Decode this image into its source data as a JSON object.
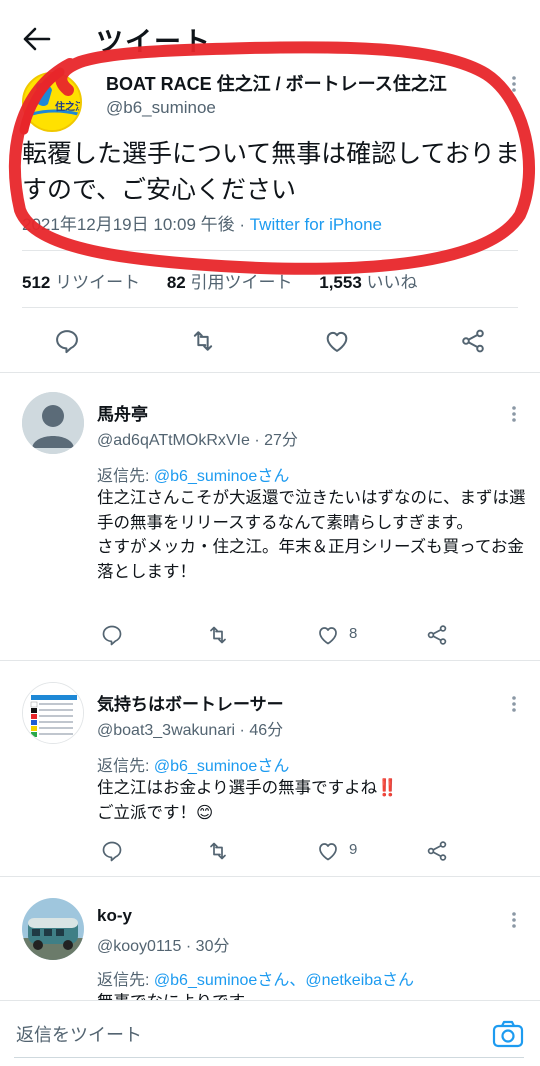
{
  "header": {
    "title": "ツイート"
  },
  "main_tweet": {
    "name": "BOAT RACE 住之江 / ボートレース住之江",
    "handle": "@b6_suminoe",
    "avatar_text": "住之江",
    "text": "転覆した選手について無事は確認しておりますので、ご安心ください",
    "timestamp": "2021年12月19日 10:09 午後",
    "separator": " · ",
    "source": "Twitter for iPhone",
    "stats": {
      "retweets_count": "512",
      "retweets_label": "リツイート",
      "quotes_count": "82",
      "quotes_label": "引用ツイート",
      "likes_count": "1,553",
      "likes_label": "いいね"
    }
  },
  "replies": [
    {
      "name": "馬舟亭",
      "handle": "@ad6qATtMOkRxVIe · 27分",
      "reply_prefix": "返信先: ",
      "reply_to": "@b6_suminoeさん",
      "body": "住之江さんこそが大返還で泣きたいはずなのに、まずは選手の無事をリリースするなんて素晴らしすぎます。\nさすがメッカ・住之江。年末＆正月シリーズも買ってお金落とします！",
      "likes": "8"
    },
    {
      "name": "気持ちはボートレーサー",
      "handle": "@boat3_3wakunari · 46分",
      "reply_prefix": "返信先: ",
      "reply_to": "@b6_suminoeさん",
      "body": "住之江はお金より選手の無事ですよね‼️\nご立派です！😊",
      "likes": "9"
    },
    {
      "name": "ko-y",
      "handle": "@kooy0115 · 30分",
      "reply_prefix": "返信先: ",
      "reply_to": "@b6_suminoeさん、@netkeibaさん",
      "body": "無事でなによりです。"
    }
  ],
  "compose": {
    "placeholder": "返信をツイート"
  },
  "colors": {
    "link": "#1d9bf0",
    "muted": "#536471",
    "scribble": "#e8262a",
    "like": "#536471"
  },
  "icons": {
    "back": "arrow-left-icon",
    "more": "more-vertical-icon",
    "reply": "comment-icon",
    "retweet": "retweet-icon",
    "like": "heart-icon",
    "share": "share-icon",
    "camera": "camera-icon"
  }
}
